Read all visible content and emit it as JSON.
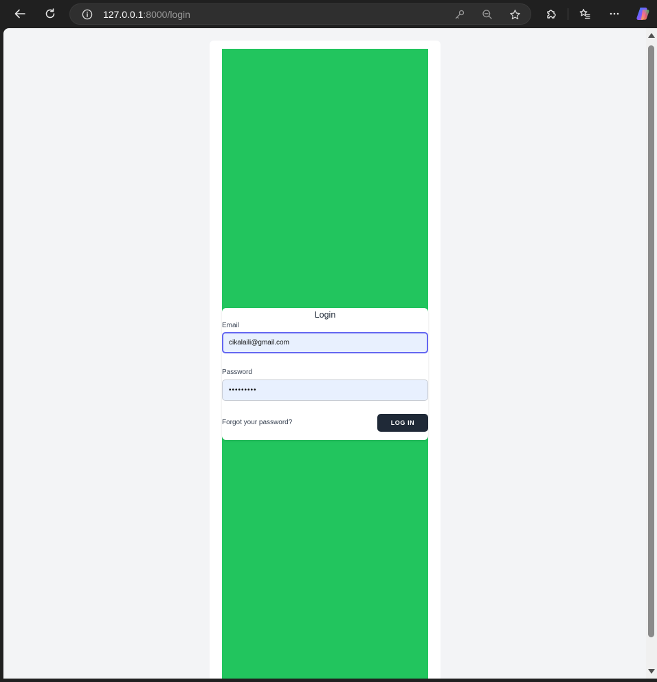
{
  "browser": {
    "url_host": "127.0.0.1",
    "url_rest": ":8000/login"
  },
  "login": {
    "title": "Login",
    "email_label": "Email",
    "email_value": "cikalaili@gmail.com",
    "password_label": "Password",
    "password_value": "•••••••••",
    "forgot_link": "Forgot your password?",
    "submit_label": "LOG IN"
  },
  "colors": {
    "background": "#f3f4f6",
    "panel": "#22c55e",
    "button": "#1f2937",
    "focus_ring": "#6366f1",
    "input_fill": "#e8f0fe"
  },
  "icons": {
    "back": "back-arrow-icon",
    "refresh": "refresh-icon",
    "site_info": "info-icon",
    "password_manager": "key-icon",
    "zoom": "zoom-out-icon",
    "favorite": "star-icon",
    "extensions": "puzzle-icon",
    "favorites": "favorites-icon",
    "more": "more-icon",
    "copilot": "copilot-icon"
  }
}
